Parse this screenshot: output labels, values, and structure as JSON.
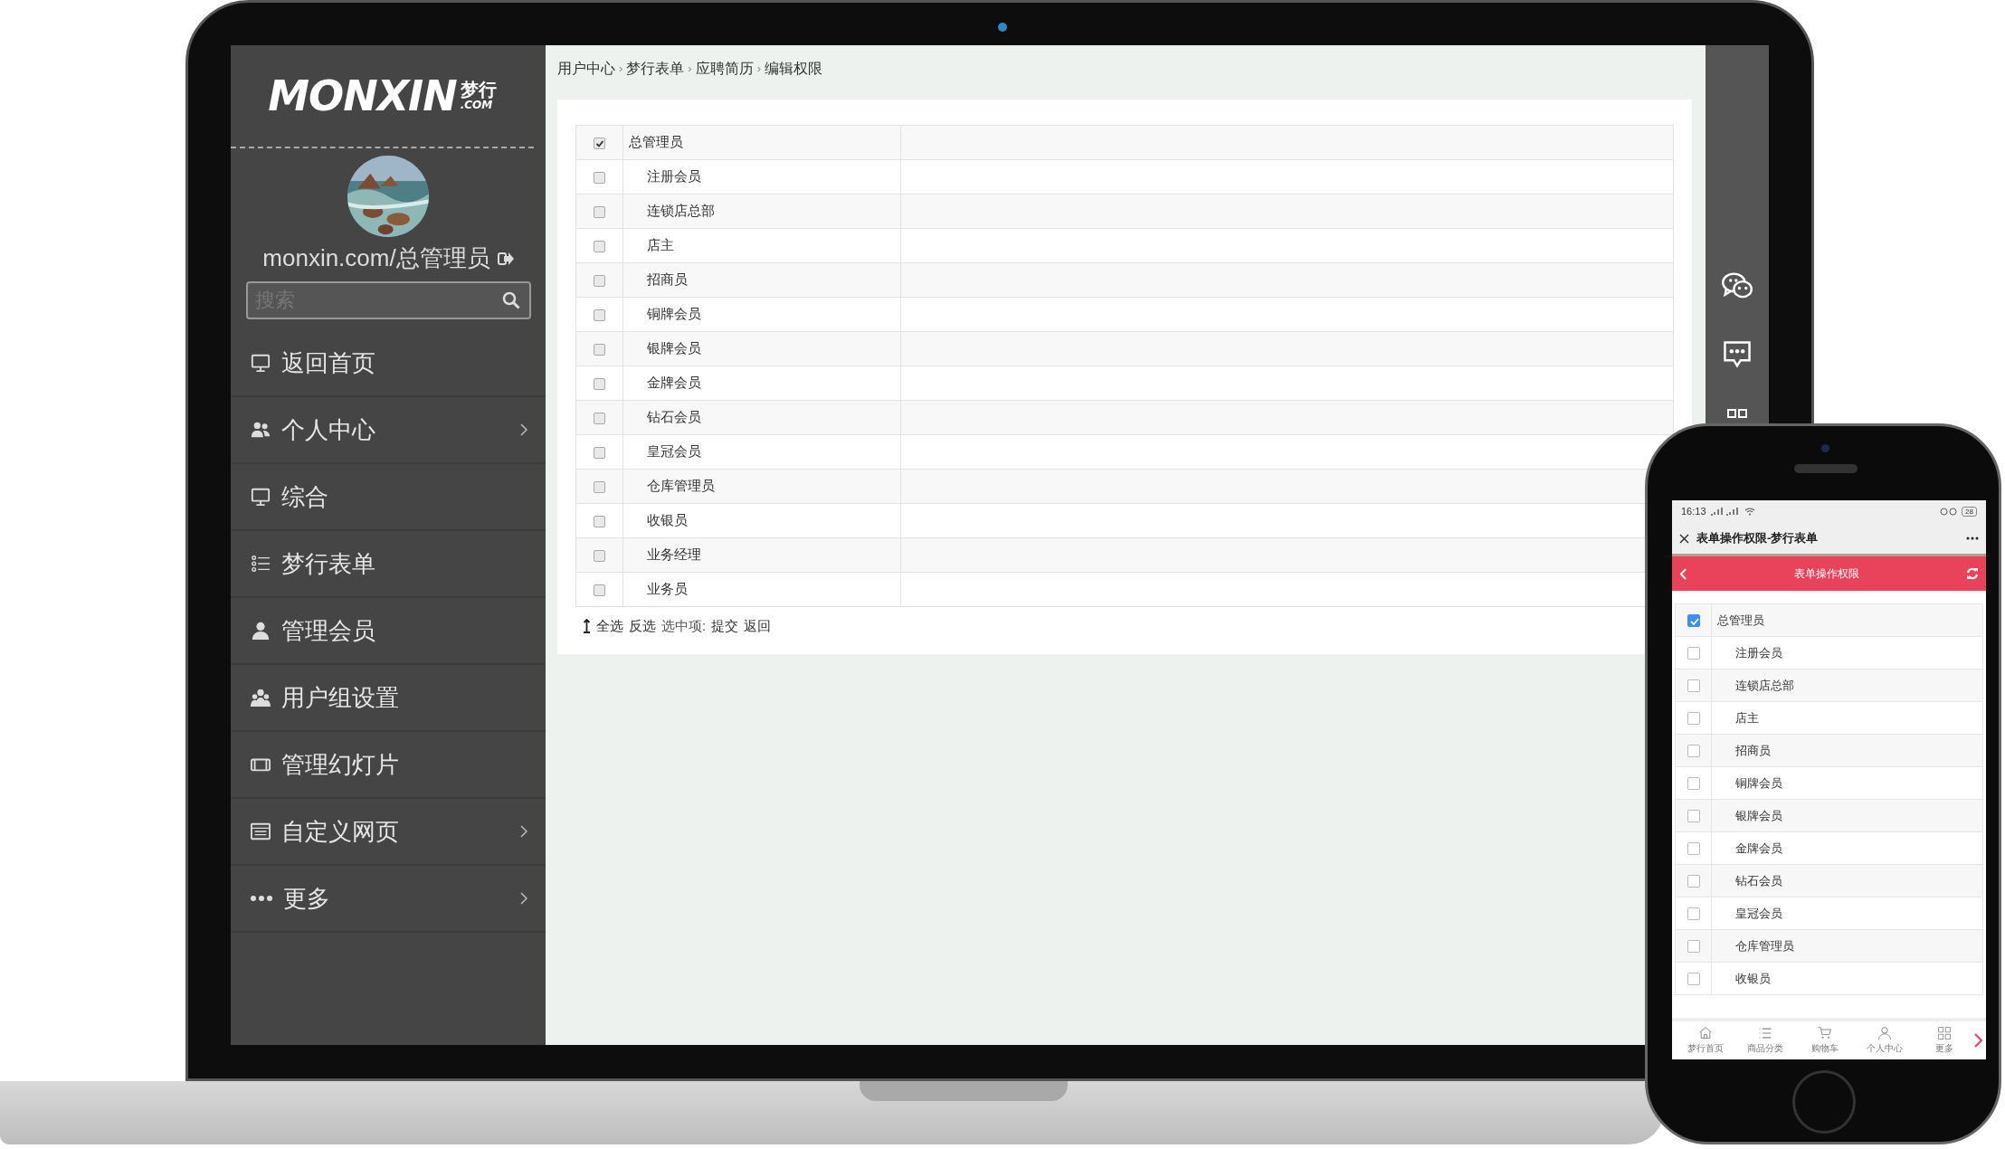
{
  "laptop": {
    "logo": {
      "word": "MONXIN",
      "cn": "梦行",
      "domain": ".COM"
    },
    "user": "monxin.com/总管理员",
    "search": {
      "placeholder": "搜索"
    },
    "menu": [
      {
        "label": "返回首页",
        "kind": "monitor",
        "has_submenu": false
      },
      {
        "label": "个人中心",
        "kind": "users",
        "has_submenu": true
      },
      {
        "label": "综合",
        "kind": "monitor",
        "has_submenu": false
      },
      {
        "label": "梦行表单",
        "kind": "list",
        "has_submenu": false
      },
      {
        "label": "管理会员",
        "kind": "user",
        "has_submenu": false
      },
      {
        "label": "用户组设置",
        "kind": "group",
        "has_submenu": false
      },
      {
        "label": "管理幻灯片",
        "kind": "film",
        "has_submenu": false
      },
      {
        "label": "自定义网页",
        "kind": "browser",
        "has_submenu": true
      },
      {
        "label": "更多",
        "kind": "dots",
        "has_submenu": true
      }
    ],
    "breadcrumb": {
      "separator": "›",
      "items": [
        "用户中心",
        "梦行表单",
        "应聘简历",
        "编辑权限"
      ]
    },
    "roles": [
      {
        "label": "总管理员",
        "checked": true,
        "children": [
          {
            "label": "注册会员",
            "checked": false
          },
          {
            "label": "连锁店总部",
            "checked": false
          },
          {
            "label": "店主",
            "checked": false
          },
          {
            "label": "招商员",
            "checked": false
          },
          {
            "label": "铜牌会员",
            "checked": false
          },
          {
            "label": "银牌会员",
            "checked": false
          },
          {
            "label": "金牌会员",
            "checked": false
          },
          {
            "label": "钻石会员",
            "checked": false
          },
          {
            "label": "皇冠会员",
            "checked": false
          },
          {
            "label": "仓库管理员",
            "checked": false
          },
          {
            "label": "收银员",
            "checked": false
          },
          {
            "label": "业务经理",
            "checked": false
          },
          {
            "label": "业务员",
            "checked": false
          }
        ]
      }
    ],
    "actions": [
      {
        "label": "全选",
        "kind": "link"
      },
      {
        "label": "反选",
        "kind": "link"
      },
      {
        "label": "选中项:",
        "kind": "label"
      },
      {
        "label": "提交",
        "kind": "link"
      },
      {
        "label": "返回",
        "kind": "link"
      }
    ]
  },
  "phone": {
    "status": {
      "time": "16:13",
      "battery": "28"
    },
    "title": "表单操作权限-梦行表单",
    "header": "表单操作权限",
    "roles": [
      {
        "label": "总管理员",
        "checked": true,
        "children": [
          {
            "label": "注册会员",
            "checked": false
          },
          {
            "label": "连锁店总部",
            "checked": false
          },
          {
            "label": "店主",
            "checked": false
          },
          {
            "label": "招商员",
            "checked": false
          },
          {
            "label": "铜牌会员",
            "checked": false
          },
          {
            "label": "银牌会员",
            "checked": false
          },
          {
            "label": "金牌会员",
            "checked": false
          },
          {
            "label": "钻石会员",
            "checked": false
          },
          {
            "label": "皇冠会员",
            "checked": false
          },
          {
            "label": "仓库管理员",
            "checked": false
          },
          {
            "label": "收银员",
            "checked": false
          }
        ]
      }
    ],
    "nav": [
      {
        "label": "梦行首页",
        "kind": "home"
      },
      {
        "label": "商品分类",
        "kind": "list"
      },
      {
        "label": "购物车",
        "kind": "cart"
      },
      {
        "label": "个人中心",
        "kind": "person"
      },
      {
        "label": "更多",
        "kind": "grid"
      }
    ]
  }
}
